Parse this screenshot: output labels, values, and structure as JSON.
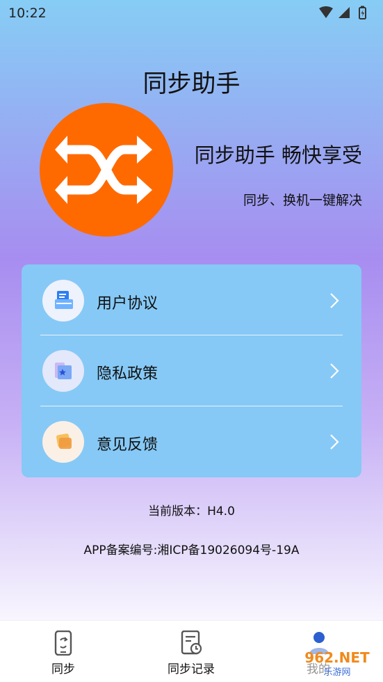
{
  "status_bar": {
    "time": "10:22"
  },
  "app_title": "同步助手",
  "hero": {
    "slogan": "同步助手 畅快享受",
    "subslogan": "同步、换机一键解决"
  },
  "colors": {
    "accent": "#ff6a00",
    "card": "#86c9f6",
    "text": "#111111"
  },
  "menu": {
    "items": [
      {
        "label": "用户协议",
        "icon": "document-icon"
      },
      {
        "label": "隐私政策",
        "icon": "privacy-folder-icon"
      },
      {
        "label": "意见反馈",
        "icon": "feedback-icon"
      }
    ]
  },
  "version_text": "当前版本：H4.0",
  "record_text": "APP备案编号:湘ICP备19026094号-19A",
  "bottom_nav": {
    "items": [
      {
        "label": "同步",
        "icon": "phone-sync-icon"
      },
      {
        "label": "同步记录",
        "icon": "record-history-icon"
      },
      {
        "label": "我的",
        "icon": "user-icon"
      }
    ]
  },
  "watermark": {
    "text": "962.NET 乐游网"
  }
}
